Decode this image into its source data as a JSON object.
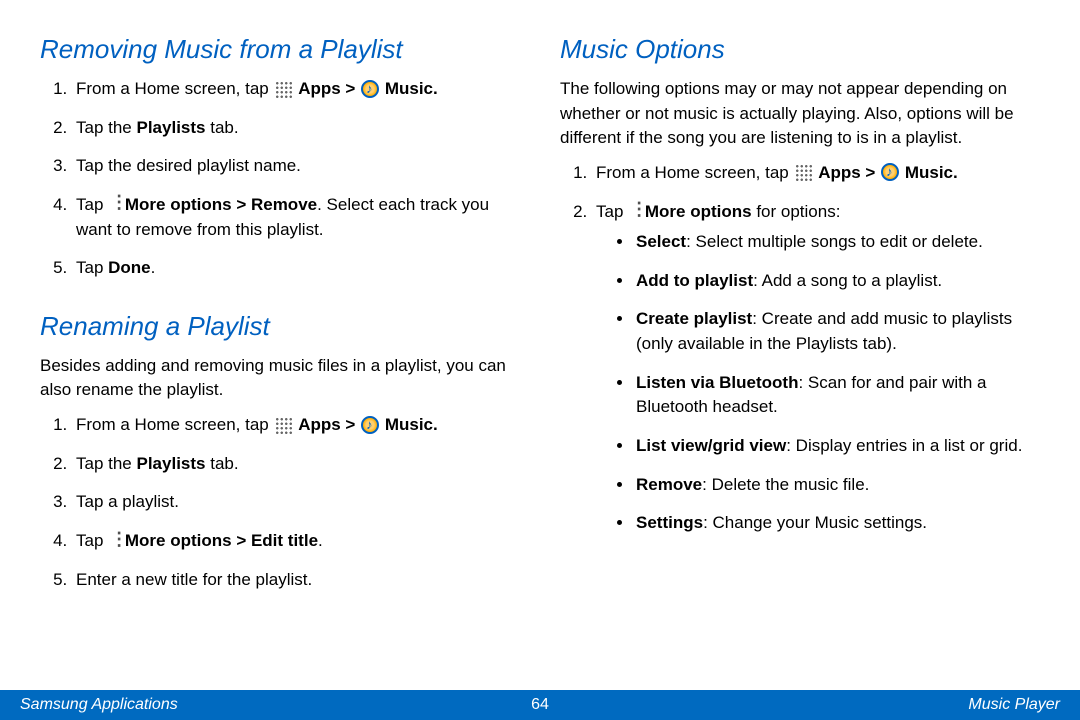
{
  "left": {
    "h1": "Removing Music from a Playlist",
    "steps1": {
      "s1a": "From a Home screen, tap ",
      "s1b": "Apps > ",
      "s1c": "Music.",
      "s2a": "Tap the ",
      "s2b": "Playlists",
      "s2c": " tab.",
      "s3": "Tap the desired playlist name.",
      "s4a": "Tap ",
      "s4b": "More options > Remove",
      "s4c": ". Select each track you want to remove from this playlist.",
      "s5a": "Tap ",
      "s5b": "Done",
      "s5c": "."
    },
    "h2": "Renaming a Playlist",
    "p2": "Besides adding and removing music files in a playlist, you can also rename the playlist.",
    "steps2": {
      "s1a": "From a Home screen, tap ",
      "s1b": "Apps > ",
      "s1c": "Music.",
      "s2a": "Tap the ",
      "s2b": "Playlists",
      "s2c": " tab.",
      "s3": "Tap a playlist.",
      "s4a": "Tap ",
      "s4b": "More options > Edit title",
      "s4c": ".",
      "s5": "Enter a new title for the playlist."
    }
  },
  "right": {
    "h1": "Music Options",
    "p1": "The following options may or may not appear depending on whether or not music is actually playing. Also, options will be different if the song you are listening to is in a playlist.",
    "steps": {
      "s1a": "From a Home screen, tap ",
      "s1b": "Apps > ",
      "s1c": "Music.",
      "s2a": "Tap ",
      "s2b": "More options",
      "s2c": " for options:"
    },
    "bullets": {
      "b1a": "Select",
      "b1b": ": Select multiple songs to edit or delete.",
      "b2a": "Add to playlist",
      "b2b": ": Add a song to a playlist.",
      "b3a": "Create playlist",
      "b3b": ": Create and add music to playlists (only available in the Playlists tab).",
      "b4a": "Listen via Bluetooth",
      "b4b": ": Scan for and pair with a Bluetooth headset.",
      "b5a": "List view/grid view",
      "b5b": ": Display entries in a list or grid.",
      "b6a": "Remove",
      "b6b": ": Delete the music file.",
      "b7a": "Settings",
      "b7b": ": Change your Music settings."
    }
  },
  "footer": {
    "left": "Samsung Applications",
    "center": "64",
    "right": "Music Player"
  }
}
